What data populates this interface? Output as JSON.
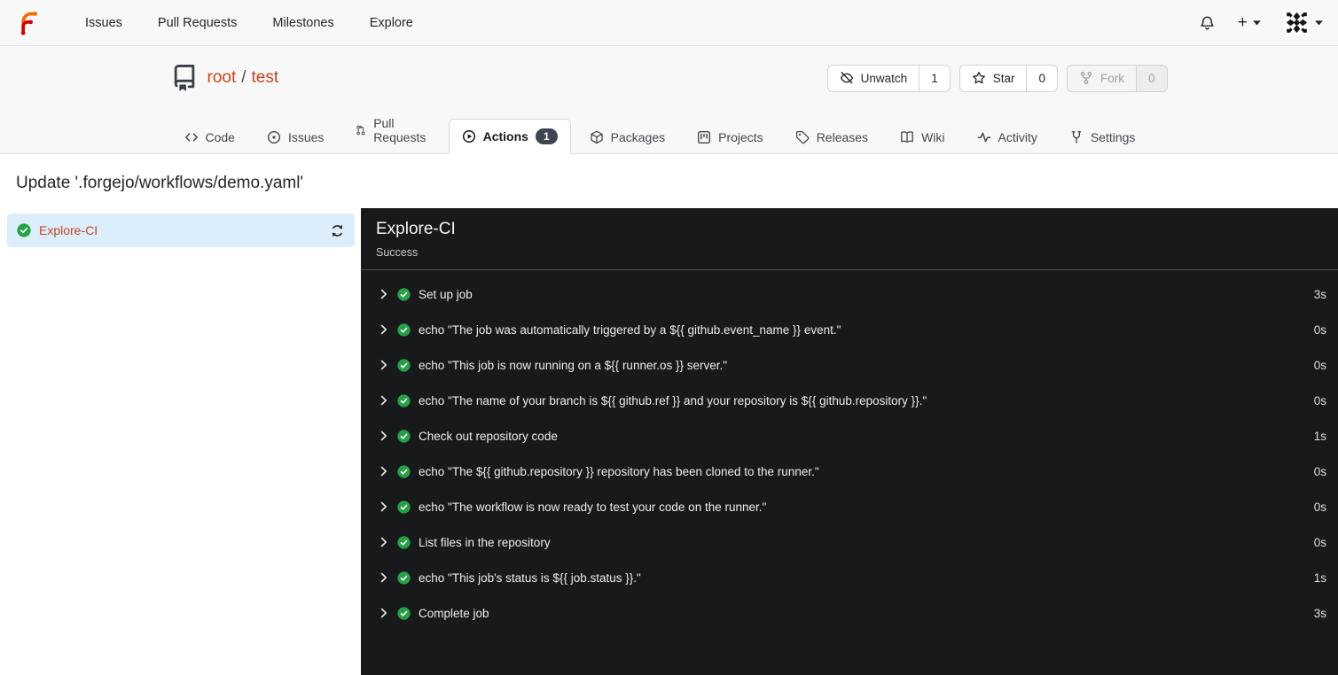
{
  "navbar": {
    "links": [
      "Issues",
      "Pull Requests",
      "Milestones",
      "Explore"
    ],
    "new_button_label": "+"
  },
  "repo_header": {
    "owner": "root",
    "slash": "/",
    "name": "test",
    "buttons": {
      "unwatch": {
        "label": "Unwatch",
        "count": "1"
      },
      "star": {
        "label": "Star",
        "count": "0"
      },
      "fork": {
        "label": "Fork",
        "count": "0",
        "disabled": true
      }
    }
  },
  "tabs": [
    {
      "label": "Code"
    },
    {
      "label": "Issues"
    },
    {
      "label": "Pull Requests"
    },
    {
      "label": "Actions",
      "badge": "1",
      "active": true
    },
    {
      "label": "Packages"
    },
    {
      "label": "Projects"
    },
    {
      "label": "Releases"
    },
    {
      "label": "Wiki"
    },
    {
      "label": "Activity"
    },
    {
      "label": "Settings"
    }
  ],
  "page": {
    "title": "Update '.forgejo/workflows/demo.yaml'"
  },
  "jobs_sidebar": {
    "job_name": "Explore-CI"
  },
  "job_panel": {
    "title": "Explore-CI",
    "status": "Success",
    "steps": [
      {
        "label": "Set up job",
        "duration": "3s"
      },
      {
        "label": "echo \"The job was automatically triggered by a ${{ github.event_name }} event.\"",
        "duration": "0s"
      },
      {
        "label": "echo \"This job is now running on a ${{ runner.os }} server.\"",
        "duration": "0s"
      },
      {
        "label": "echo \"The name of your branch is ${{ github.ref }} and your repository is ${{ github.repository }}.\"",
        "duration": "0s"
      },
      {
        "label": "Check out repository code",
        "duration": "1s"
      },
      {
        "label": "echo \"The ${{ github.repository }} repository has been cloned to the runner.\"",
        "duration": "0s"
      },
      {
        "label": "echo \"The workflow is now ready to test your code on the runner.\"",
        "duration": "0s"
      },
      {
        "label": "List files in the repository",
        "duration": "0s"
      },
      {
        "label": "echo \"This job's status is ${{ job.status }}.\"",
        "duration": "1s"
      },
      {
        "label": "Complete job",
        "duration": "3s"
      }
    ]
  },
  "icons": [
    "forgejo-logo-icon",
    "bell-icon",
    "plus-icon",
    "caret-down-icon",
    "avatar-identicon",
    "repo-book-icon",
    "eye-slash-icon",
    "star-icon",
    "fork-icon",
    "code-icon",
    "issue-circle-icon",
    "pull-request-icon",
    "play-circle-icon",
    "package-icon",
    "project-board-icon",
    "tag-icon",
    "wiki-book-icon",
    "activity-pulse-icon",
    "settings-tool-icon",
    "check-circle-icon",
    "refresh-icon",
    "chevron-right-icon"
  ],
  "colors": {
    "accent_orange": "#c8441f",
    "success_green": "#26a148",
    "panel_background": "#18191b",
    "active_job_background": "#dcedfb",
    "header_background": "#f8f8f8"
  }
}
